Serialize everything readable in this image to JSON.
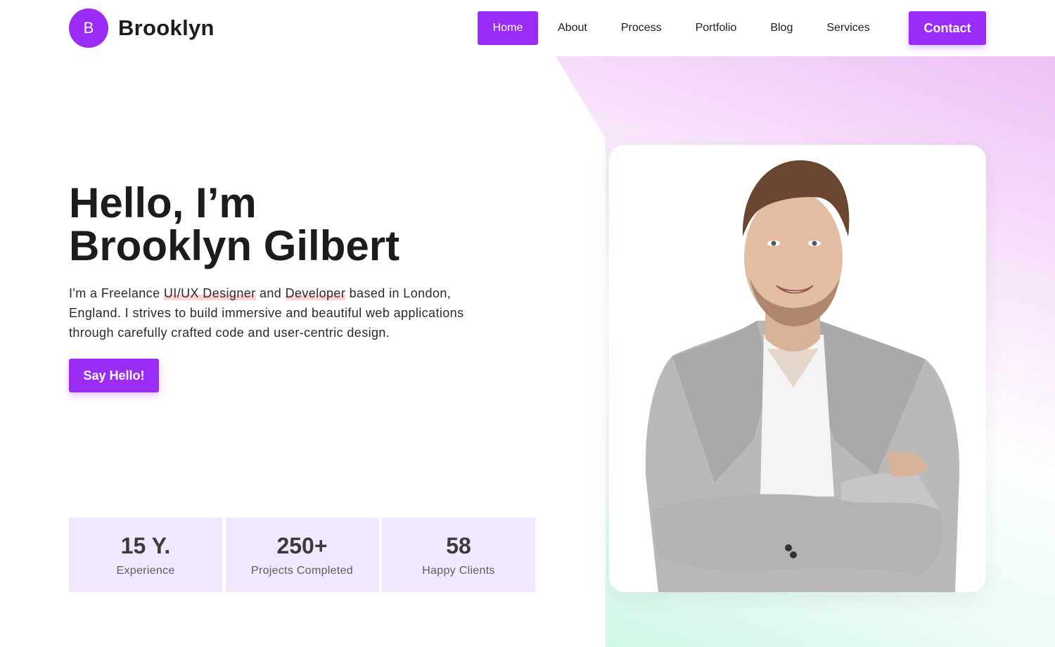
{
  "brand": {
    "logo_letter": "B",
    "name": "Brooklyn"
  },
  "nav": {
    "items": [
      {
        "label": "Home",
        "active": true
      },
      {
        "label": "About"
      },
      {
        "label": "Process"
      },
      {
        "label": "Portfolio"
      },
      {
        "label": "Blog"
      },
      {
        "label": "Services"
      }
    ],
    "contact_label": "Contact"
  },
  "hero": {
    "title_line1": "Hello, I’m",
    "title_line2": "Brooklyn Gilbert",
    "desc_part1": "I'm a Freelance ",
    "desc_highlight1": "UI/UX Designer",
    "desc_part2": " and ",
    "desc_highlight2": "Developer",
    "desc_part3": " based in London, England. I strives to build immersive and beautiful web applications through carefully crafted code and user-centric design.",
    "cta_label": "Say Hello!"
  },
  "stats": [
    {
      "value": "15 Y.",
      "label": "Experience"
    },
    {
      "value": "250+",
      "label": "Projects Completed"
    },
    {
      "value": "58",
      "label": "Happy Clients"
    }
  ],
  "colors": {
    "accent": "#9a2cf5",
    "stat_bg": "#f1e7fe",
    "highlight": "#ffd3d3"
  }
}
